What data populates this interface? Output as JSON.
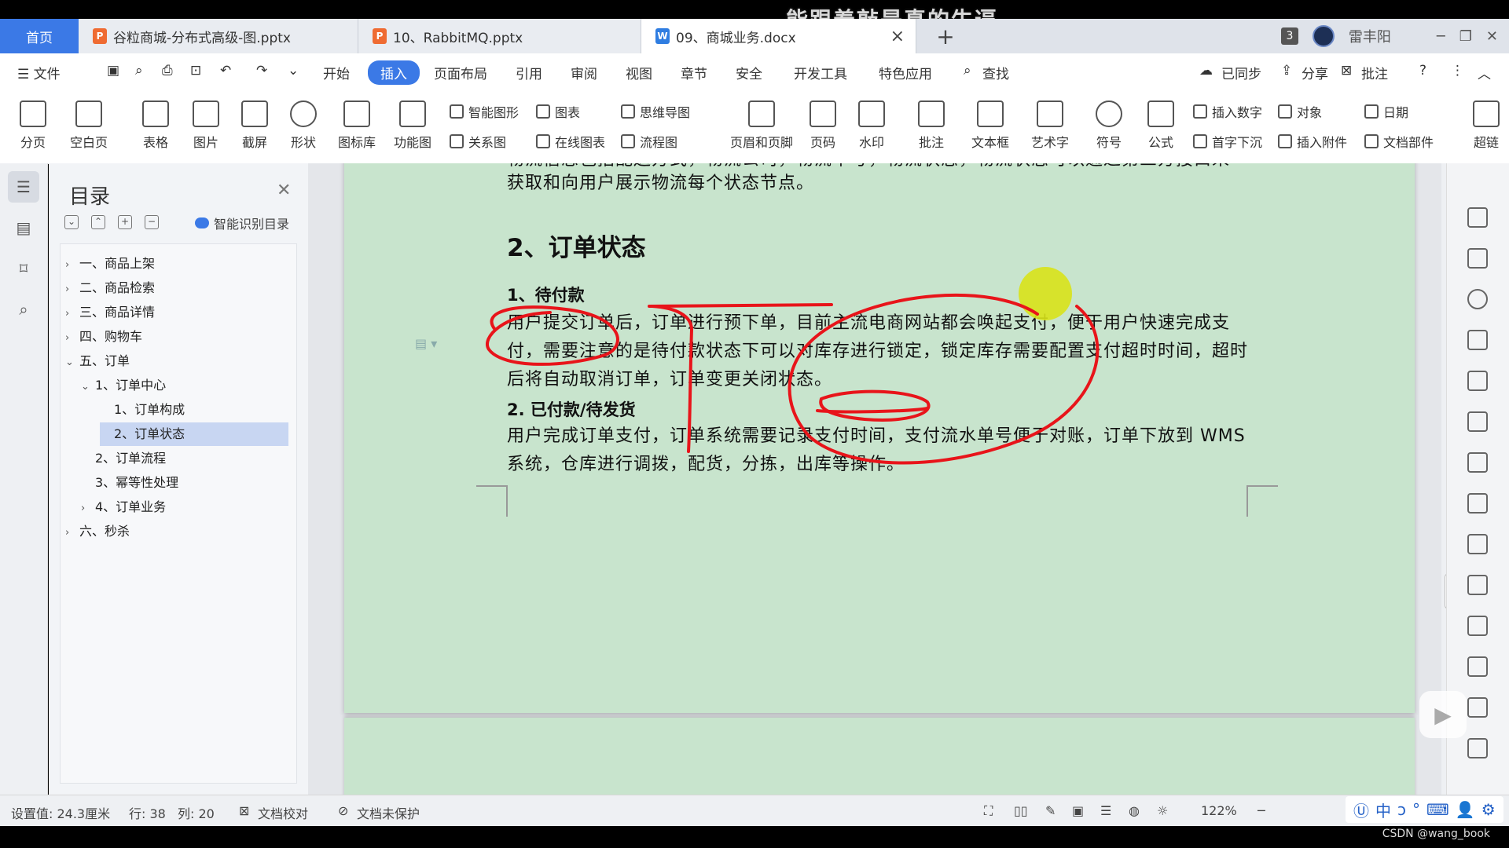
{
  "overlay_caption": "能跟着敲是真的牛逼",
  "tabs": {
    "home": "首页",
    "files": [
      {
        "label": "谷粒商城-分布式高级-图.pptx",
        "type": "ppt",
        "type_icon": "P"
      },
      {
        "label": "10、RabbitMQ.pptx",
        "type": "ppt",
        "type_icon": "P"
      },
      {
        "label": "09、商城业务.docx",
        "type": "doc",
        "type_icon": "W"
      }
    ],
    "close_glyph": "×",
    "new_tab_glyph": "+"
  },
  "window": {
    "badge": "3",
    "user": "雷丰阳",
    "min": "─",
    "restore": "❐",
    "close": "✕"
  },
  "menubar": {
    "file": "☰ 文件",
    "items": [
      "开始",
      "插入",
      "页面布局",
      "引用",
      "审阅",
      "视图",
      "章节",
      "安全",
      "开发工具",
      "特色应用"
    ],
    "active": "插入",
    "search": "查找",
    "synced": "已同步",
    "share": "分享",
    "comment": "批注"
  },
  "ribbon": {
    "big": [
      "分页",
      "空白页",
      "表格",
      "图片",
      "截屏",
      "形状",
      "图标库",
      "功能图",
      "页眉和页脚",
      "页码",
      "水印",
      "批注",
      "文本框",
      "艺术字",
      "符号",
      "公式",
      "超链"
    ],
    "small": [
      "智能图形",
      "图表",
      "思维导图",
      "关系图",
      "在线图表",
      "流程图",
      "插入数字",
      "对象",
      "日期",
      "首字下沉",
      "插入附件",
      "文档部件"
    ]
  },
  "toc": {
    "title": "目录",
    "smart": "智能识别目录",
    "items": [
      {
        "label": "一、商品上架",
        "level": 0,
        "arrow": "›"
      },
      {
        "label": "二、商品检索",
        "level": 0,
        "arrow": "›"
      },
      {
        "label": "三、商品详情",
        "level": 0,
        "arrow": "›"
      },
      {
        "label": "四、购物车",
        "level": 0,
        "arrow": "›"
      },
      {
        "label": "五、订单",
        "level": 0,
        "arrow": "⌄"
      },
      {
        "label": "1、订单中心",
        "level": 1,
        "arrow": "⌄"
      },
      {
        "label": "1、订单构成",
        "level": 2,
        "arrow": ""
      },
      {
        "label": "2、订单状态",
        "level": 2,
        "arrow": "",
        "selected": true
      },
      {
        "label": "2、订单流程",
        "level": 1,
        "arrow": ""
      },
      {
        "label": "3、幂等性处理",
        "level": 1,
        "arrow": ""
      },
      {
        "label": "4、订单业务",
        "level": 1,
        "arrow": "›"
      },
      {
        "label": "六、秒杀",
        "level": 0,
        "arrow": "›"
      }
    ]
  },
  "document": {
    "top_cut_line": "物流信息包括配送方式，物流公司，物流单号，物流状态，物流状态可以通过第三方接口来",
    "top_line2": "获取和向用户展示物流每个状态节点。",
    "heading": "2、订单状态",
    "sub1": "1、待付款",
    "para1": "用户提交订单后，订单进行预下单，目前主流电商网站都会唤起支付，便于用户快速完成支付，需要注意的是待付款状态下可以对库存进行锁定，锁定库存需要配置支付超时时间，超时后将自动取消订单，订单变更关闭状态。",
    "sub2": "2. 已付款/待发货",
    "para2": "用户完成订单支付，订单系统需要记录支付时间，支付流水单号便于对账，订单下放到 WMS 系统，仓库进行调拨，配货，分拣，出库等操作。"
  },
  "status": {
    "setting": "设置值: 24.3厘米",
    "row": "行: 38",
    "col": "列: 20",
    "proof": "文档校对",
    "protect": "文档未保护",
    "zoom": "122%"
  },
  "ime": [
    "中",
    "ↄ",
    "°",
    "⌨",
    "👤",
    "⚙"
  ],
  "watermark_credit": "CSDN @wang_book",
  "colors": {
    "accent": "#3b79e6",
    "page_bg": "#c8e4cd",
    "annotation_red": "#e8141a",
    "pointer_yellow": "#d8e21a"
  }
}
